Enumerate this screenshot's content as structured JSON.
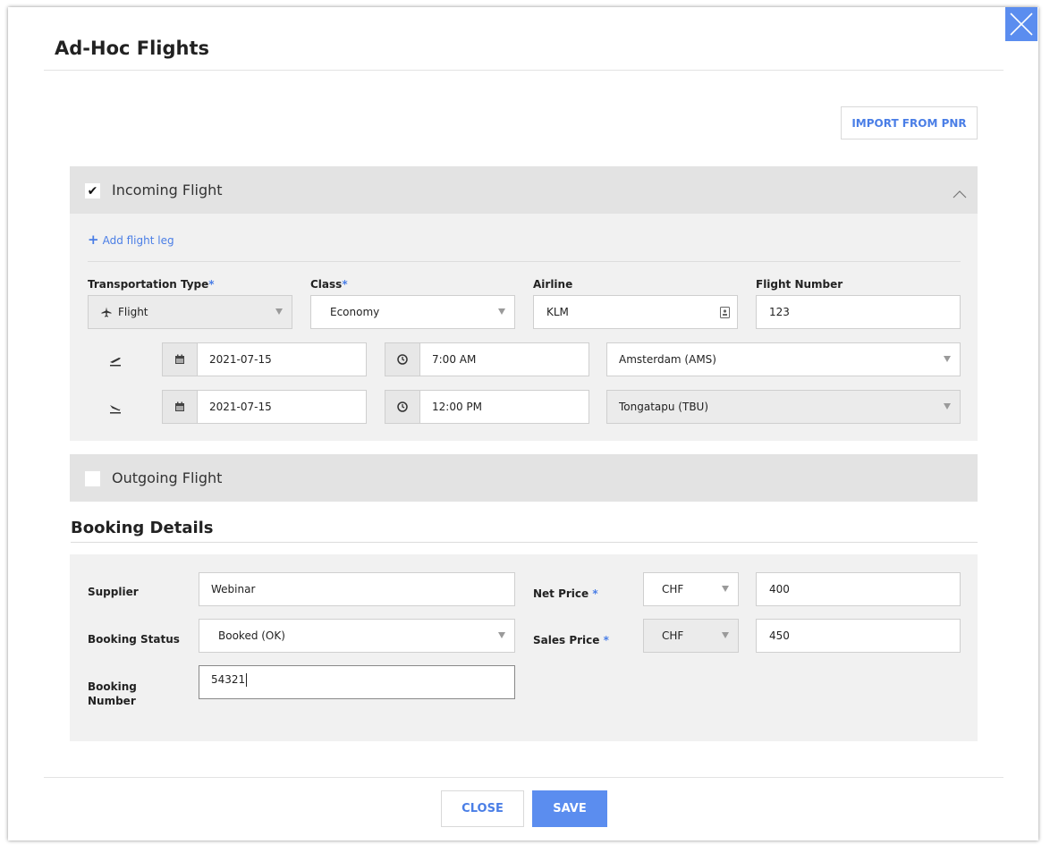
{
  "modal": {
    "title": "Ad-Hoc Flights",
    "import_label": "IMPORT FROM PNR",
    "close_label": "CLOSE",
    "save_label": "SAVE",
    "close_icon": "close-x-icon"
  },
  "incoming": {
    "label": "Incoming Flight",
    "checked": true,
    "check_mark": "✔",
    "add_leg_plus": "+",
    "add_leg_label": "Add flight leg",
    "labels": {
      "transport_type": "Transportation Type",
      "class": "Class",
      "airline": "Airline",
      "flight_number": "Flight Number",
      "required_mark": "*"
    },
    "values": {
      "transport_type": "Flight",
      "class": "Economy",
      "airline": "KLM",
      "flight_number": "123"
    },
    "departure": {
      "date": "2021-07-15",
      "time": "7:00 AM",
      "airport": "Amsterdam (AMS)"
    },
    "arrival": {
      "date": "2021-07-15",
      "time": "12:00 PM",
      "airport": "Tongatapu (TBU)"
    }
  },
  "outgoing": {
    "label": "Outgoing Flight",
    "checked": false
  },
  "booking": {
    "title": "Booking Details",
    "labels": {
      "supplier": "Supplier",
      "status": "Booking Status",
      "number_line1": "Booking",
      "number_line2": "Number",
      "net_price": "Net Price",
      "sales_price": "Sales Price",
      "required_mark": "*"
    },
    "values": {
      "supplier": "Webinar",
      "status": "Booked (OK)",
      "number": "54321",
      "net_currency": "CHF",
      "net_price": "400",
      "sales_currency": "CHF",
      "sales_price": "450"
    }
  },
  "colors": {
    "accent": "#5b8def",
    "link": "#4a7ee6",
    "section_header": "#e3e3e3",
    "section_body": "#f1f1f1"
  }
}
